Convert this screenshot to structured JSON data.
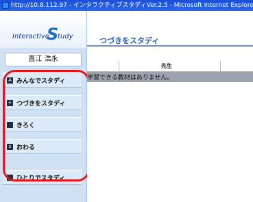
{
  "window": {
    "title": "http://10.8.112.97 - インタラクティブスタディVer.2.5 - Microsoft Internet Explorer"
  },
  "logo": {
    "part1": "Interactive",
    "part2": "S",
    "part3": "tudy"
  },
  "user": {
    "name": "直江 浩永"
  },
  "sidebar": {
    "items": [
      {
        "label": "みんなでスタディ",
        "icon": "a-icon",
        "glyph": "A"
      },
      {
        "label": "つづきをスタディ",
        "icon": "play-icon",
        "glyph": "+"
      },
      {
        "label": "きろく",
        "icon": "record-icon",
        "glyph": ""
      },
      {
        "label": "おわる",
        "icon": "close-icon",
        "glyph": "x"
      },
      {
        "label": "ひとりでスタディ",
        "icon": "square-icon",
        "glyph": ""
      }
    ]
  },
  "main": {
    "title": "つづきをスタディ",
    "table": {
      "column_header": "先生",
      "empty_message": "学習できる教材はありません。"
    }
  },
  "colors": {
    "accent": "#2a5fb1",
    "highlight_border": "#e0161c",
    "sidebar_bg": "#cfe1f3"
  }
}
